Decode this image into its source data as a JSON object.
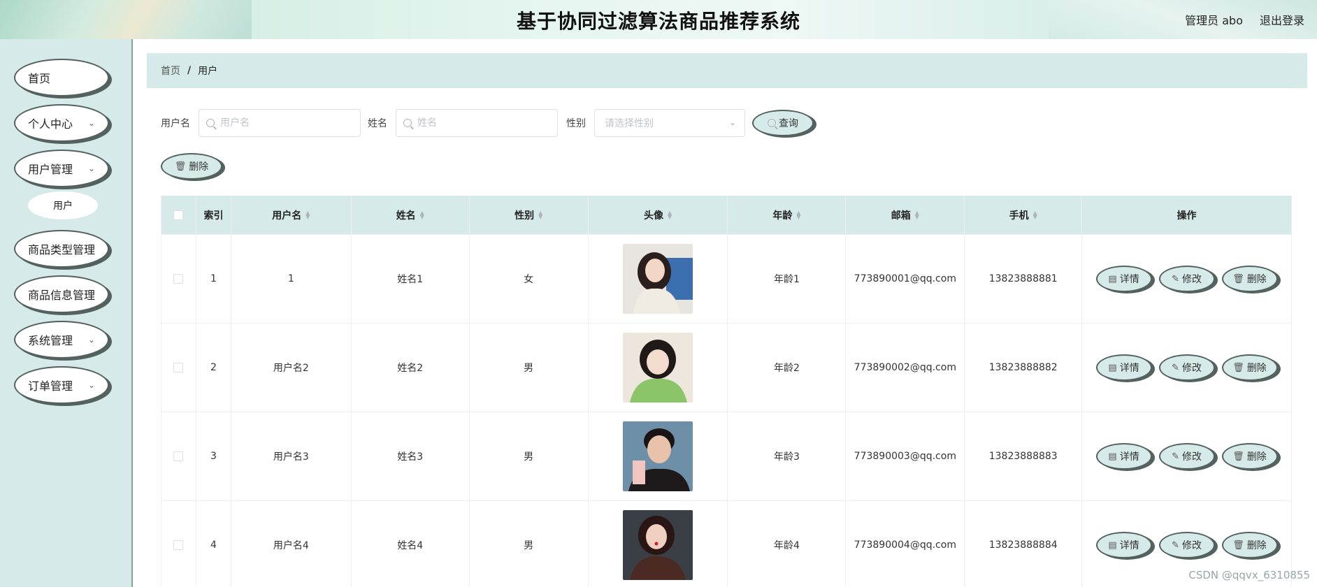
{
  "header": {
    "title": "基于协同过滤算法商品推荐系统",
    "user_label": "管理员 abo",
    "logout_label": "退出登录"
  },
  "sidebar": {
    "items": [
      {
        "label": "首页"
      },
      {
        "label": "个人中心"
      },
      {
        "label": "用户管理"
      },
      {
        "label": "用户"
      },
      {
        "label": "商品类型管理"
      },
      {
        "label": "商品信息管理"
      },
      {
        "label": "系统管理"
      },
      {
        "label": "订单管理"
      }
    ]
  },
  "breadcrumb": {
    "home": "首页",
    "separator": "/",
    "current": "用户"
  },
  "search": {
    "username_label": "用户名",
    "username_placeholder": "用户名",
    "name_label": "姓名",
    "name_placeholder": "姓名",
    "gender_label": "性别",
    "gender_placeholder": "请选择性别",
    "query_button": "查询"
  },
  "toolbar": {
    "delete_button": "删除"
  },
  "table": {
    "headers": [
      "索引",
      "用户名",
      "姓名",
      "性别",
      "头像",
      "年龄",
      "邮箱",
      "手机",
      "操作"
    ],
    "rows": [
      {
        "index": "1",
        "username": "1",
        "name": "姓名1",
        "gender": "女",
        "age": "年龄1",
        "email": "773890001@qq.com",
        "phone": "13823888881"
      },
      {
        "index": "2",
        "username": "用户名2",
        "name": "姓名2",
        "gender": "男",
        "age": "年龄2",
        "email": "773890002@qq.com",
        "phone": "13823888882"
      },
      {
        "index": "3",
        "username": "用户名3",
        "name": "姓名3",
        "gender": "男",
        "age": "年龄3",
        "email": "773890003@qq.com",
        "phone": "13823888883"
      },
      {
        "index": "4",
        "username": "用户名4",
        "name": "姓名4",
        "gender": "男",
        "age": "年龄4",
        "email": "773890004@qq.com",
        "phone": "13823888884"
      }
    ],
    "actions": {
      "detail": "详情",
      "edit": "修改",
      "delete": "删除"
    }
  },
  "icons": {
    "search": "search-icon",
    "chevron": "chevron-down-icon",
    "trash": "trash-icon",
    "document": "document-icon",
    "pencil": "pencil-icon",
    "sort": "sort-caret-icon"
  },
  "colors": {
    "panel": "#d7eaea",
    "pill_border": "#53615f"
  },
  "watermark": "CSDN @qqvx_6310855"
}
